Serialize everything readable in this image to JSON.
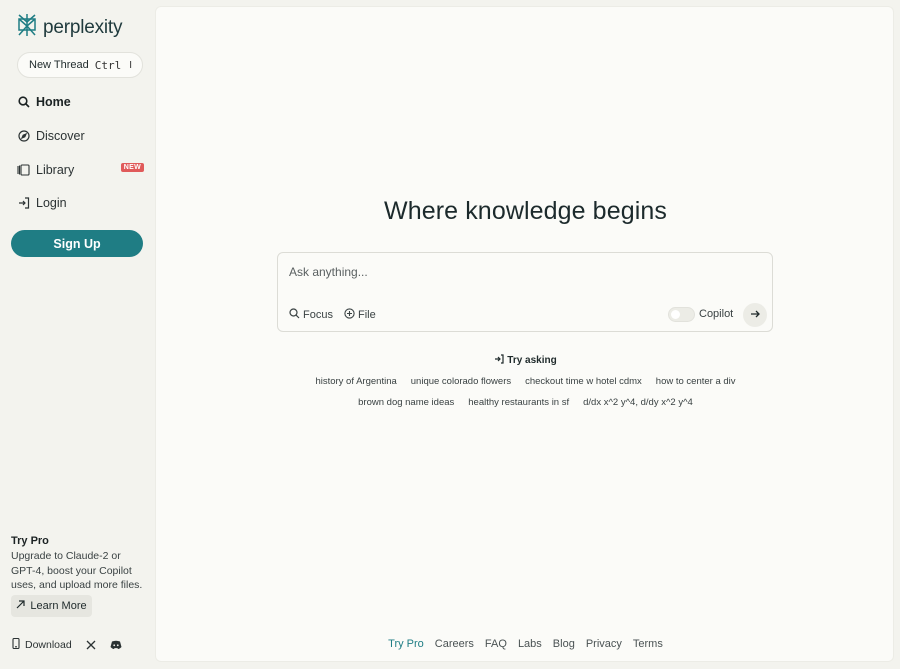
{
  "brand": {
    "name": "perplexity",
    "accent": "#1f7d84",
    "badge_color": "#e05a5a"
  },
  "sidebar": {
    "new_thread": {
      "label": "New Thread",
      "kbd": "Ctrl",
      "kbd_key": "I"
    },
    "items": [
      {
        "label": "Home",
        "icon": "search-icon",
        "active": true
      },
      {
        "label": "Discover",
        "icon": "compass-icon"
      },
      {
        "label": "Library",
        "icon": "library-icon",
        "badge": "NEW"
      },
      {
        "label": "Login",
        "icon": "login-icon"
      }
    ],
    "signup_label": "Sign Up",
    "trypro": {
      "title": "Try Pro",
      "description": "Upgrade to Claude-2 or GPT-4, boost your Copilot uses, and upload more files.",
      "learn_more": "Learn More"
    },
    "footer": {
      "download": "Download"
    }
  },
  "main": {
    "headline": "Where knowledge begins",
    "ask": {
      "placeholder": "Ask anything...",
      "focus_label": "Focus",
      "file_label": "File",
      "copilot_label": "Copilot",
      "copilot_on": false
    },
    "try_asking": "Try asking",
    "suggestions_row1": [
      "history of Argentina",
      "unique colorado flowers",
      "checkout time w hotel cdmx",
      "how to center a div"
    ],
    "suggestions_row2": [
      "brown dog name ideas",
      "healthy restaurants in sf",
      "d/dx x^2 y^4, d/dy x^2 y^4"
    ],
    "footer_links": [
      "Try Pro",
      "Careers",
      "FAQ",
      "Labs",
      "Blog",
      "Privacy",
      "Terms"
    ]
  }
}
